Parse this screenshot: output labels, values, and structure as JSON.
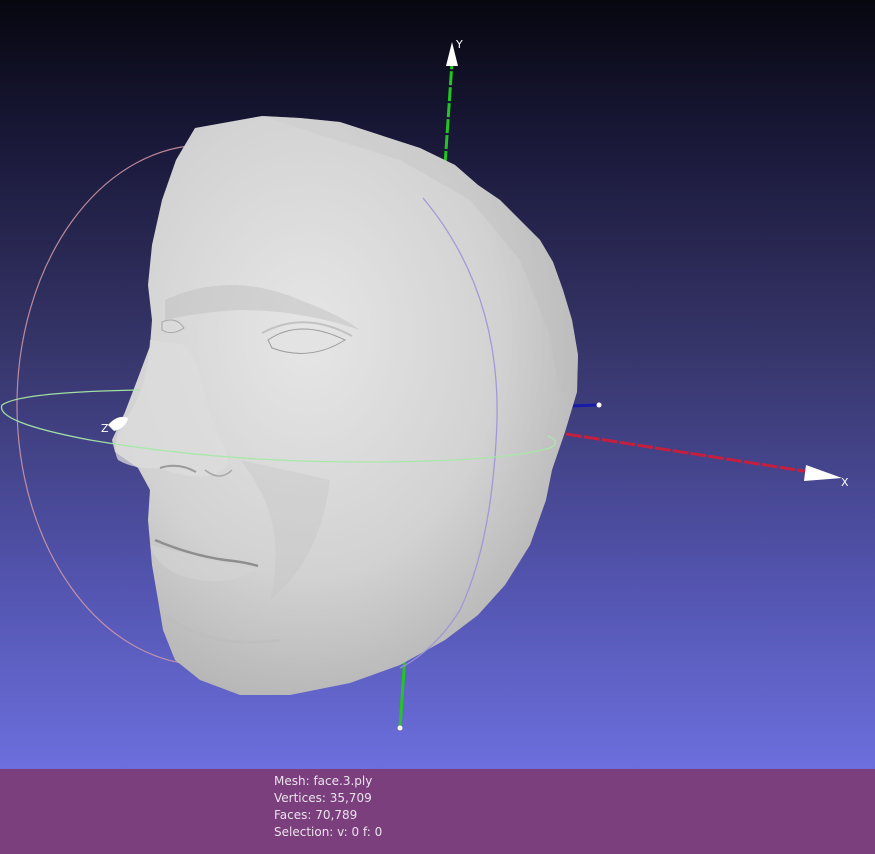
{
  "viewport": {
    "axes": {
      "x_label": "X",
      "y_label": "Y",
      "z_label": "Z"
    },
    "colors": {
      "x_axis": "#c3203f",
      "y_axis": "#23c423",
      "z_axis": "#1a1aa8",
      "trackball_horizontal": "#a7e8a7",
      "trackball_vertical": "#9b93d8",
      "trackball_depth": "#d59aa6",
      "mesh": "#d6d6d6"
    }
  },
  "info": {
    "mesh": "Mesh: face.3.ply",
    "vertices": "Vertices: 35,709",
    "faces": "Faces: 70,789",
    "selection": "Selection: v: 0 f: 0"
  }
}
